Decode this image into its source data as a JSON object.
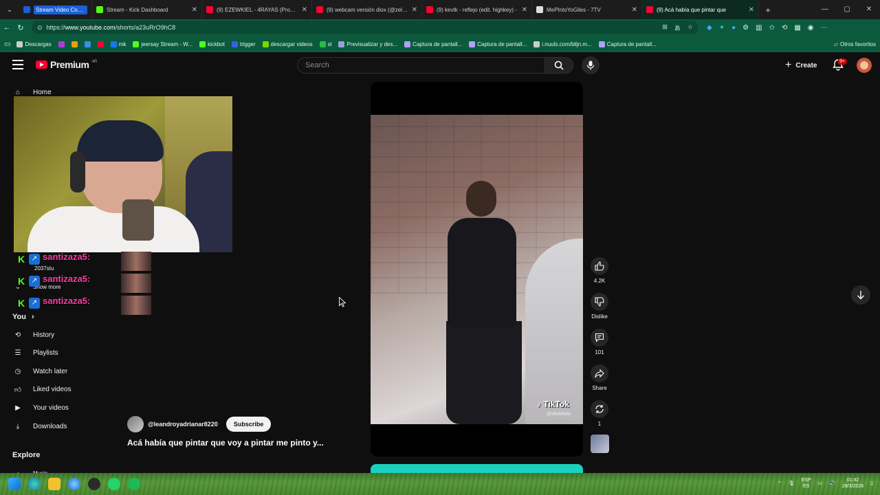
{
  "browser": {
    "tabs": [
      {
        "title": "Stream Video Content",
        "favicon_color": "#1a5fd6"
      },
      {
        "title": "Stream - Kick Dashboard",
        "favicon_color": "#53fc18"
      },
      {
        "title": "(9) EZEWKIEL - 4RAYAS (Prod. 9sa",
        "favicon_color": "#ff0033"
      },
      {
        "title": "(9) webcam versión diox (@zellwo",
        "favicon_color": "#ff0033"
      },
      {
        "title": "(9) kevtk - reflejo (edit. highkey) -",
        "favicon_color": "#ff0033"
      },
      {
        "title": "MePIntoYoGiles - 7TV",
        "favicon_color": "#dddddd"
      },
      {
        "title": "(9) Acá había que pintar que",
        "favicon_color": "#ff0033"
      }
    ],
    "url_prefix": "https://",
    "url_host": "www.youtube.com",
    "url_path": "/shorts/a23uRrO9hC8",
    "bookmarks": [
      {
        "label": "Descargas",
        "color": "#cccccc"
      },
      {
        "label": "",
        "color": "#b03ad6"
      },
      {
        "label": "",
        "color": "#e8a000"
      },
      {
        "label": "",
        "color": "#3a8ee6"
      },
      {
        "label": "",
        "color": "#ff0033"
      },
      {
        "label": "mk",
        "color": "#1877f2"
      },
      {
        "label": "jeersay Stream - W...",
        "color": "#53fc18"
      },
      {
        "label": "kickbot",
        "color": "#53fc18"
      },
      {
        "label": "trigger",
        "color": "#3a5fe6"
      },
      {
        "label": "descargar videos",
        "color": "#7ad600"
      },
      {
        "label": "sl",
        "color": "#2ab84e"
      },
      {
        "label": "Previsualizar y des...",
        "color": "#9aa0d6"
      },
      {
        "label": "Captura de pantall...",
        "color": "#b0a0ff"
      },
      {
        "label": "Captura de pantall...",
        "color": "#b0a0ff"
      },
      {
        "label": "i.nuuls.com/biljn.m...",
        "color": "#cccccc"
      },
      {
        "label": "Captura de pantall...",
        "color": "#b0a0ff"
      }
    ],
    "other_bookmarks": "Otros favoritos"
  },
  "youtube": {
    "logo_text": "Premium",
    "logo_region": "AR",
    "search_placeholder": "Search",
    "create_label": "Create",
    "notifications_badge": "9+"
  },
  "sidebar": {
    "home": "Home",
    "chat_user": "2037stu",
    "show_more": "Show more",
    "you_heading": "You",
    "items": [
      {
        "label": "History",
        "icon": "history-icon"
      },
      {
        "label": "Playlists",
        "icon": "playlists-icon"
      },
      {
        "label": "Watch later",
        "icon": "clock-icon"
      },
      {
        "label": "Liked videos",
        "icon": "thumbs-up-icon"
      },
      {
        "label": "Your videos",
        "icon": "play-square-icon"
      },
      {
        "label": "Downloads",
        "icon": "download-icon"
      }
    ],
    "explore_heading": "Explore",
    "explore_first": "Music"
  },
  "overlay": {
    "chat_name": "santizaza5:",
    "chat_rows": 3
  },
  "short": {
    "watermark": "TikTok",
    "watermark_handle": "@ellobitobi",
    "channel": "@leandroyadrianar8220",
    "subscribe": "Subscribe",
    "title": "Acá había que pintar que voy a pintar me pinto y...",
    "likes": "4.2K",
    "dislike_label": "Dislike",
    "comments": "101",
    "share_label": "Share",
    "remix_count": "1"
  },
  "taskbar": {
    "lang_top": "ESP",
    "lang_bottom": "ES",
    "time": "01:42",
    "date": "28/3/2026"
  },
  "colors": {
    "yt_red": "#ff0033",
    "addressbar_green": "#0b5a3e",
    "kick_green": "#53fc18",
    "chat_pink": "#ff3ea5"
  }
}
